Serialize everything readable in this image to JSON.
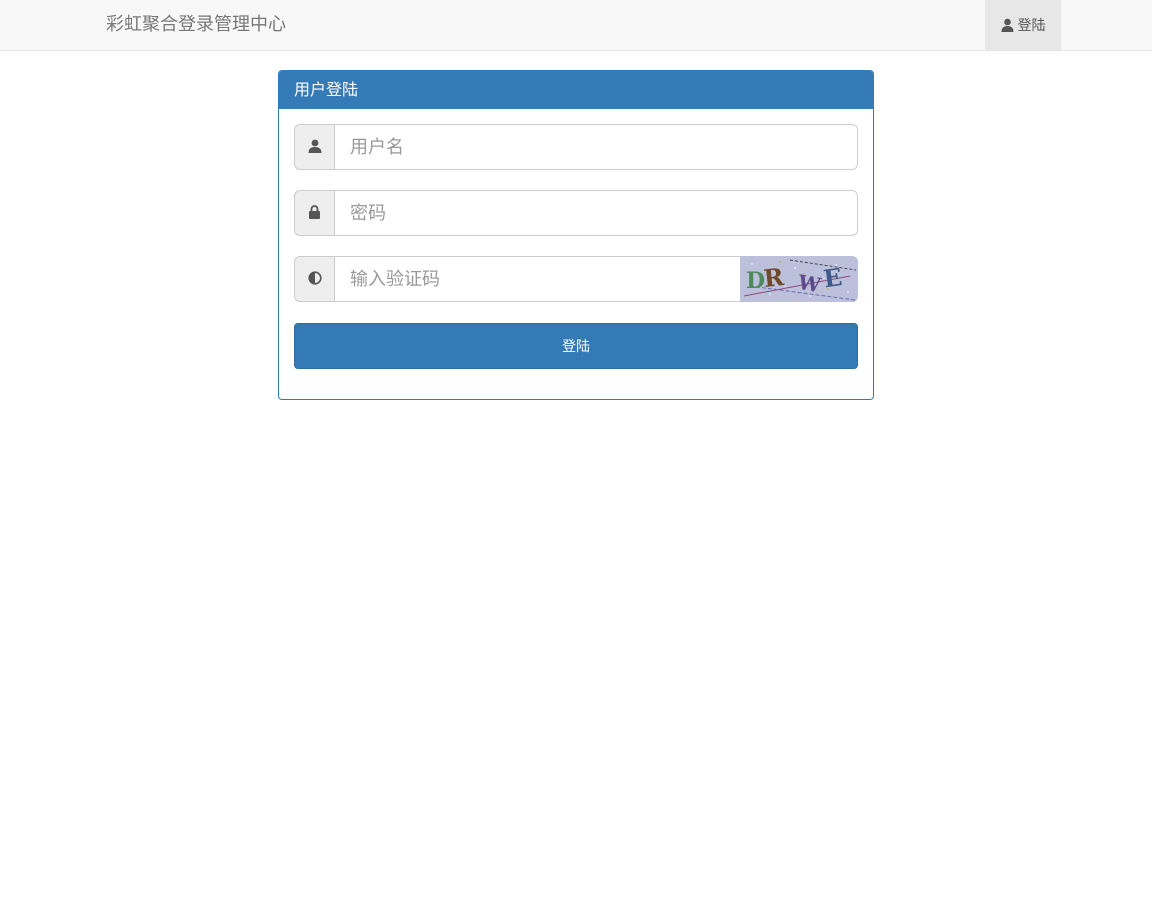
{
  "navbar": {
    "brand": "彩虹聚合登录管理中心",
    "login_link": "登陆",
    "login_icon": "user-icon"
  },
  "panel": {
    "title": "用户登陆"
  },
  "form": {
    "username": {
      "placeholder": "用户名",
      "value": "",
      "icon": "user-icon"
    },
    "password": {
      "placeholder": "密码",
      "value": "",
      "icon": "lock-icon"
    },
    "captcha": {
      "placeholder": "输入验证码",
      "value": "",
      "icon": "adjust-icon",
      "image_text": "DRWE"
    },
    "submit_label": "登陆"
  },
  "colors": {
    "primary": "#337ab7",
    "navbar_bg": "#f8f8f8",
    "addon_bg": "#eeeeee",
    "placeholder": "#999999"
  }
}
